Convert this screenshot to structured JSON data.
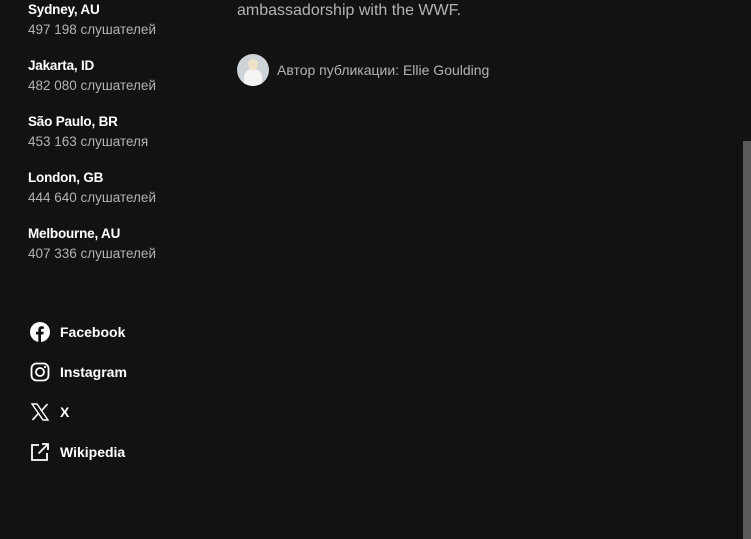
{
  "cities": [
    {
      "name": "Sydney, AU",
      "listeners": "497 198 слушателей"
    },
    {
      "name": "Jakarta, ID",
      "listeners": "482 080 слушателей"
    },
    {
      "name": "São Paulo, BR",
      "listeners": "453 163 слушателя"
    },
    {
      "name": "London, GB",
      "listeners": "444 640 слушателей"
    },
    {
      "name": "Melbourne, AU",
      "listeners": "407 336 слушателей"
    }
  ],
  "socials": [
    {
      "label": "Facebook",
      "icon": "facebook-icon"
    },
    {
      "label": "Instagram",
      "icon": "instagram-icon"
    },
    {
      "label": "X",
      "icon": "x-icon"
    },
    {
      "label": "Wikipedia",
      "icon": "external-link-icon"
    }
  ],
  "bio": {
    "tail_text": "ambassadorship with the WWF.",
    "author_label": "Автор публикации: Ellie Goulding"
  }
}
